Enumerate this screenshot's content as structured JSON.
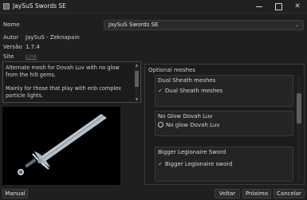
{
  "window": {
    "title": "JaySuS Swords SE"
  },
  "info": {
    "name_label": "Nome",
    "name_value": "JaySuS Swords SE",
    "author_label": "Autor",
    "author_value": "JaySuS - Zeknapain",
    "version_label": "Versão",
    "version_value": "1.7.4",
    "site_label": "Site",
    "site_value": "Link"
  },
  "description": {
    "paragraph1": "Alternate mesh for Dovah Luv with no glow from the hilt gems.",
    "paragraph2": "Mainly for those that play with enb complex particle lights."
  },
  "options": {
    "title": "Optional meshes",
    "groups": [
      {
        "title": "Dual Sheath meshes",
        "option": "Dual Sheath meshes",
        "type": "checkbox",
        "checked": true
      },
      {
        "title": "No Glow Dovah Luv",
        "option": "No glow Dovah Luv",
        "type": "radio",
        "checked": false
      },
      {
        "title": "Bigger Legionaire Sword",
        "option": "Bigger Legionaire sword",
        "type": "checkbox",
        "checked": true
      }
    ]
  },
  "buttons": {
    "manual": "Manual",
    "back": "Voltar",
    "next": "Próximo",
    "cancel": "Cancelar"
  },
  "colors": {
    "accent_check": "#4aa36a",
    "link": "#3c8a4a"
  }
}
